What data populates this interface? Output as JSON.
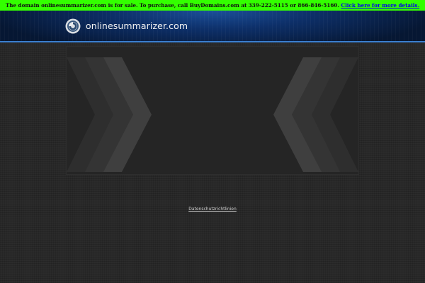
{
  "sale_bar": {
    "text": "The domain onlinesummarizer.com is for sale. To purchase, call BuyDomains.com at 339-222-5115 or 866-846-5160. ",
    "link_text": "Click here for more details."
  },
  "header": {
    "site_name": "onlinesummarizer.com",
    "logo_icon": "circle-logo-icon"
  },
  "footer": {
    "privacy_link": "Datenschutzrichtlinien"
  },
  "colors": {
    "sale_bar_bg": "#33ff00",
    "header_bg": "#0d2f68",
    "page_bg": "#2b2b2b"
  }
}
